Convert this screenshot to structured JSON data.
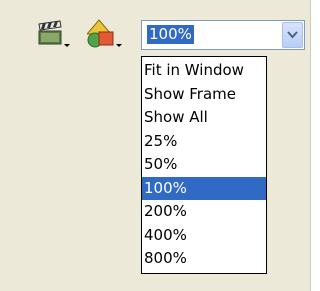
{
  "toolbar": {
    "scene_button": {
      "icon": "clapperboard-icon"
    },
    "symbol_button": {
      "icon": "shapes-icon"
    },
    "zoom_combo": {
      "value": "100%"
    }
  },
  "zoom_menu": {
    "items": [
      {
        "label": "Fit in Window",
        "selected": false
      },
      {
        "label": "Show Frame",
        "selected": false
      },
      {
        "label": "Show All",
        "selected": false
      },
      {
        "label": "25%",
        "selected": false
      },
      {
        "label": "50%",
        "selected": false
      },
      {
        "label": "100%",
        "selected": true
      },
      {
        "label": "200%",
        "selected": false
      },
      {
        "label": "400%",
        "selected": false
      },
      {
        "label": "800%",
        "selected": false
      }
    ]
  },
  "colors": {
    "panel": "#ece9d8",
    "selection": "#316ac5",
    "combo_border": "#7f9db9"
  }
}
